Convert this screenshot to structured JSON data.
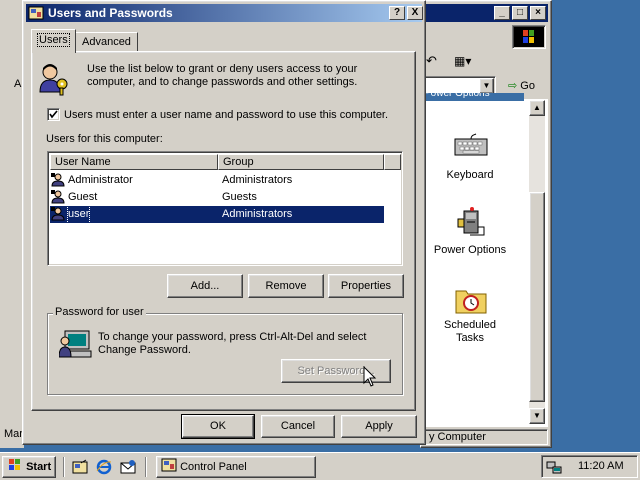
{
  "background_windows": {
    "control_panel": {
      "toolbar_address_go": "Go",
      "partial_header": "Power Options",
      "icons": [
        {
          "label_1": "Keyboard",
          "label_2": "",
          "icon": "keyboard-icon"
        },
        {
          "label_1": "Power Options",
          "label_2": "",
          "icon": "power-options-icon"
        },
        {
          "label_1": "Scheduled",
          "label_2": "Tasks",
          "icon": "scheduled-tasks-icon"
        }
      ],
      "status_text": "y Computer"
    },
    "left_window_fragments": {
      "status": "Mar"
    }
  },
  "dialog": {
    "title": "Users and Passwords",
    "help_button": "?",
    "close_button": "X",
    "tabs": [
      "Users",
      "Advanced"
    ],
    "intro_text": "Use the list below to grant or deny users access to your computer, and to change passwords and other settings.",
    "checkbox_label": "Users must enter a user name and password to use this computer.",
    "checkbox_checked": true,
    "users_label": "Users for this computer:",
    "columns": [
      "User Name",
      "Group"
    ],
    "users": [
      {
        "name": "Administrator",
        "group": "Administrators",
        "selected": false
      },
      {
        "name": "Guest",
        "group": "Guests",
        "selected": false
      },
      {
        "name": "user",
        "group": "Administrators",
        "selected": true
      }
    ],
    "buttons": {
      "add": "Add...",
      "remove": "Remove",
      "properties": "Properties"
    },
    "password_group_label": "Password for user",
    "password_text": "To change your password, press Ctrl-Alt-Del and select Change Password.",
    "set_password": "Set Password...",
    "ok": "OK",
    "cancel": "Cancel",
    "apply": "Apply"
  },
  "taskbar": {
    "start": "Start",
    "task_button": "Control Panel",
    "clock": "11:20 AM"
  },
  "colors": {
    "title_bar": "#0a246a",
    "desktop": "#3a6ea5",
    "face": "#d4d0c8",
    "selection": "#0a246a"
  }
}
